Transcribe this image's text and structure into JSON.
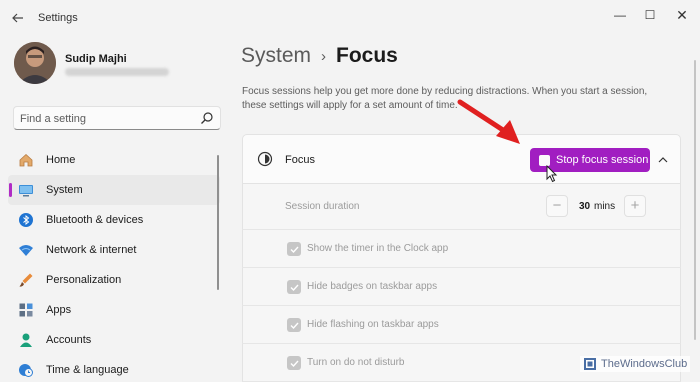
{
  "window": {
    "title": "Settings",
    "controls": {
      "minimize": "—",
      "maximize": "☐",
      "close": "✕"
    }
  },
  "user": {
    "name": "Sudip Majhi"
  },
  "search": {
    "placeholder": "Find a setting"
  },
  "sidebar": {
    "items": [
      {
        "label": "Home",
        "icon": "home-icon",
        "active": false
      },
      {
        "label": "System",
        "icon": "system-icon",
        "active": true
      },
      {
        "label": "Bluetooth & devices",
        "icon": "bluetooth-icon",
        "active": false
      },
      {
        "label": "Network & internet",
        "icon": "wifi-icon",
        "active": false
      },
      {
        "label": "Personalization",
        "icon": "brush-icon",
        "active": false
      },
      {
        "label": "Apps",
        "icon": "apps-icon",
        "active": false
      },
      {
        "label": "Accounts",
        "icon": "accounts-icon",
        "active": false
      },
      {
        "label": "Time & language",
        "icon": "clock-globe-icon",
        "active": false
      }
    ]
  },
  "breadcrumb": {
    "parent": "System",
    "separator": "›",
    "current": "Focus"
  },
  "description": "Focus sessions help you get more done by reducing distractions. When you start a session, these settings will apply for a set amount of time.",
  "focus_card": {
    "label": "Focus",
    "button_label": "Stop focus session",
    "session_duration": {
      "label": "Session duration",
      "value": "30",
      "unit": "mins",
      "minus": "−",
      "plus": "+"
    },
    "options": [
      {
        "label": "Show the timer in the Clock app",
        "checked": true
      },
      {
        "label": "Hide badges on taskbar apps",
        "checked": true
      },
      {
        "label": "Hide flashing on taskbar apps",
        "checked": true
      },
      {
        "label": "Turn on do not disturb",
        "checked": true
      }
    ]
  },
  "colors": {
    "accent": "#a11ec1",
    "annotation_arrow": "#e02020"
  },
  "watermark": {
    "text": "TheWindowsClub"
  }
}
